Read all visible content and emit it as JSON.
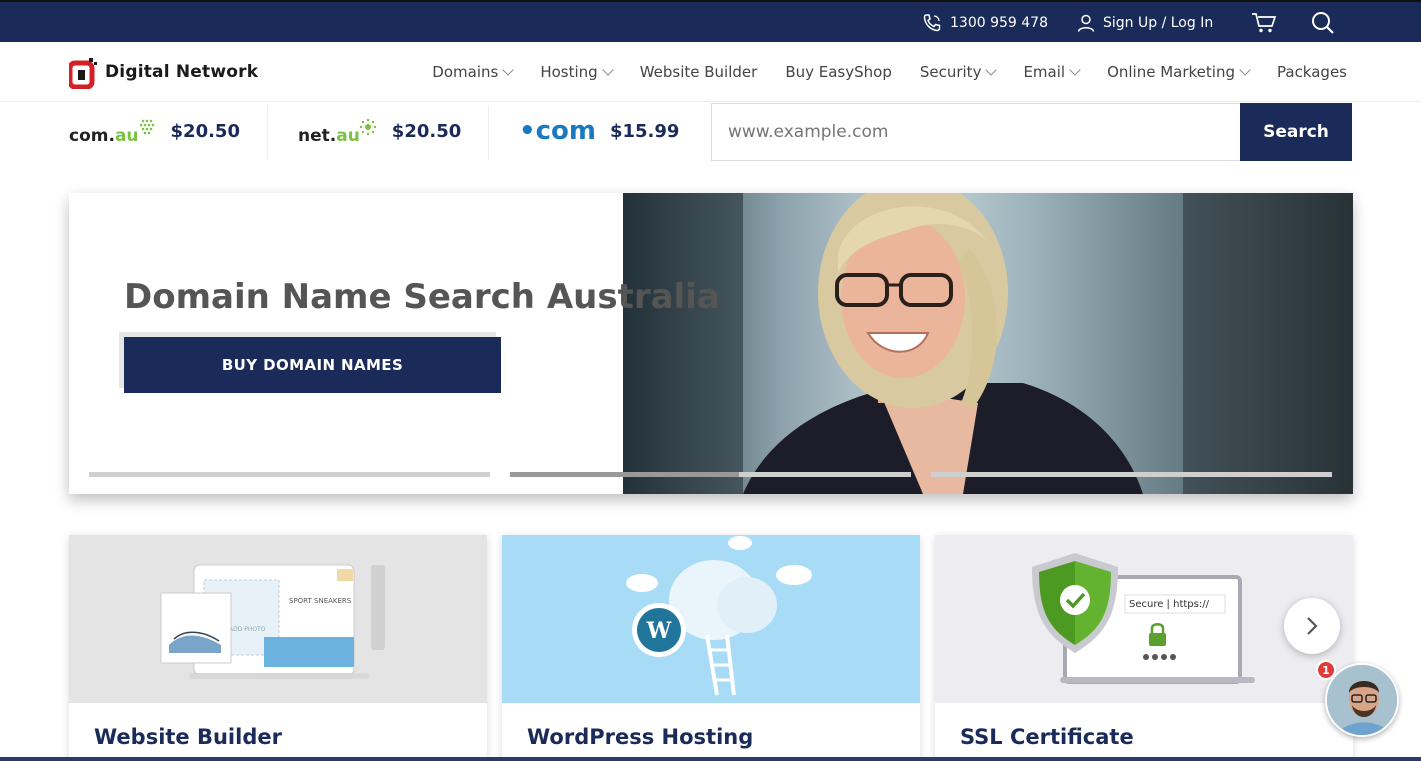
{
  "topbar": {
    "phone": "1300 959 478",
    "account": "Sign Up / Log In",
    "icons": [
      "phone-icon",
      "user-icon",
      "cart-icon",
      "search-icon"
    ]
  },
  "header": {
    "logo_text": "Digital Network",
    "nav": [
      {
        "label": "Domains",
        "dropdown": true
      },
      {
        "label": "Hosting",
        "dropdown": true
      },
      {
        "label": "Website Builder",
        "dropdown": false
      },
      {
        "label": "Buy EasyShop",
        "dropdown": false
      },
      {
        "label": "Security",
        "dropdown": true
      },
      {
        "label": "Email",
        "dropdown": true
      },
      {
        "label": "Online Marketing",
        "dropdown": true
      },
      {
        "label": "Packages",
        "dropdown": false
      }
    ]
  },
  "domains": {
    "tlds": [
      {
        "prefix": "com.",
        "suffix": "au",
        "price": "$20.50"
      },
      {
        "prefix": "net.",
        "suffix": "au",
        "price": "$20.50"
      },
      {
        "prefix": "•com",
        "suffix": "",
        "price": "$15.99"
      }
    ],
    "search_placeholder": "www.example.com",
    "search_button": "Search"
  },
  "hero": {
    "title": "Domain Name Search Australia",
    "button": "BUY DOMAIN NAMES",
    "slides_progress": [
      0,
      0.57,
      0
    ]
  },
  "cards": [
    {
      "title": "Website Builder",
      "image_text": "SPORT SNEAKERS",
      "image_subtext": "ADD PHOTO"
    },
    {
      "title": "WordPress Hosting"
    },
    {
      "title": "SSL Certificate",
      "image_text": "Secure | https://"
    }
  ],
  "chat": {
    "badge": "1"
  },
  "colors": {
    "navy": "#1b2b59",
    "green": "#7cc242",
    "blue": "#1a7ac0"
  }
}
